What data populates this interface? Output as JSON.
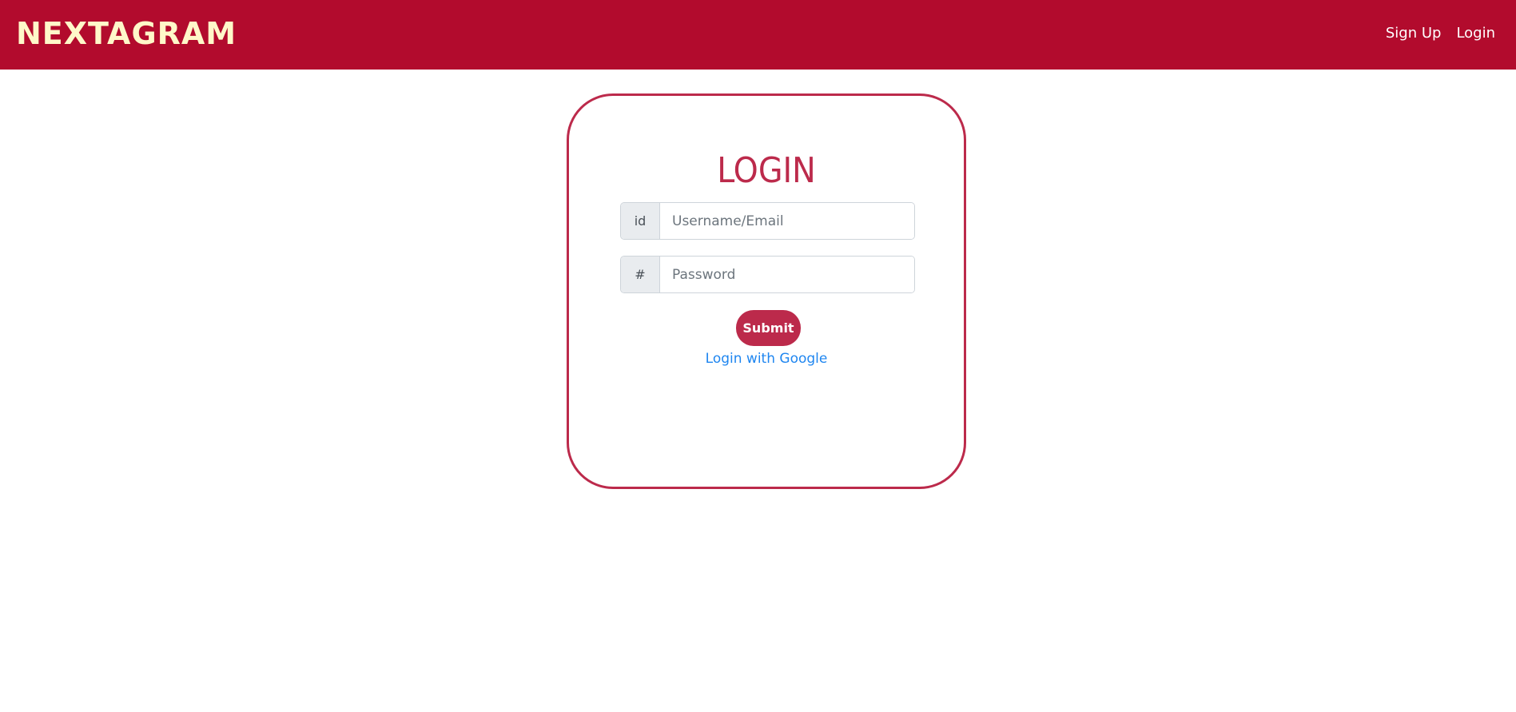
{
  "navbar": {
    "brand": "NEXTAGRAM",
    "links": [
      {
        "label": "Sign Up"
      },
      {
        "label": "Login"
      }
    ],
    "colors": {
      "background": "#b20b2d",
      "brand": "#fff8c9",
      "link": "#ffffff"
    }
  },
  "login": {
    "title": "LOGIN",
    "id_addon": "id",
    "id_placeholder": "Username/Email",
    "id_value": "",
    "password_addon": "#",
    "password_placeholder": "Password",
    "password_value": "",
    "submit_label": "Submit",
    "google_link": "Login with Google",
    "colors": {
      "accent": "#bc2a4b",
      "link": "#1f86f0"
    }
  }
}
